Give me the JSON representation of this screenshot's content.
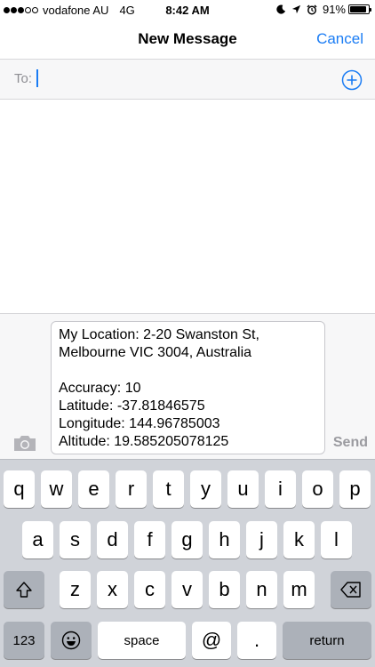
{
  "status_bar": {
    "carrier": "vodafone AU",
    "network": "4G",
    "time": "8:42 AM",
    "battery_percent": "91%",
    "battery_level": 0.91,
    "signal_bars_filled": 3,
    "signal_bars_total": 5
  },
  "nav": {
    "title": "New Message",
    "cancel_label": "Cancel"
  },
  "recipient": {
    "label": "To:",
    "value": ""
  },
  "compose": {
    "message_text": "My Location: 2-20 Swanston St,\nMelbourne VIC 3004, Australia\n\nAccuracy: 10\nLatitude: -37.81846575\nLongitude: 144.96785003\nAltitude: 19.585205078125",
    "send_label": "Send"
  },
  "keyboard": {
    "row1": [
      "q",
      "w",
      "e",
      "r",
      "t",
      "y",
      "u",
      "i",
      "o",
      "p"
    ],
    "row2": [
      "a",
      "s",
      "d",
      "f",
      "g",
      "h",
      "j",
      "k",
      "l"
    ],
    "row3": [
      "z",
      "x",
      "c",
      "v",
      "b",
      "n",
      "m"
    ],
    "numbers_label": "123",
    "space_label": "space",
    "at_label": "@",
    "period_label": ".",
    "return_label": "return"
  },
  "colors": {
    "accent": "#1a7cf4",
    "keyboard_bg": "#d0d3d9",
    "dark_key": "#acb1b9",
    "send_disabled": "#9b9ba0"
  },
  "icons": {
    "add_contact": "plus-circle-icon",
    "camera": "camera-icon",
    "shift": "shift-arrow-icon",
    "backspace": "backspace-icon",
    "emoji": "emoji-icon",
    "moon": "moon-icon",
    "location": "location-arrow-icon",
    "alarm": "alarm-clock-icon"
  }
}
